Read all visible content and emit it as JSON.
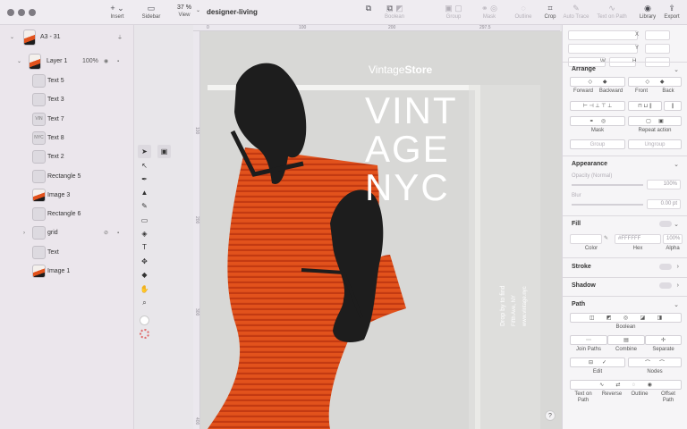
{
  "toolbar": {
    "sidebar_label": "Sidebar",
    "zoom_value": "37 %",
    "view_label": "View",
    "document_title": "designer-living",
    "insert_label": "Insert",
    "boolean_label": "Boolean",
    "group_label": "Group",
    "mask_label": "Mask",
    "outline_label": "Outline",
    "crop_label": "Crop",
    "auto_trace_label": "Auto Trace",
    "text_on_path_label": "Text on Path",
    "library_label": "Library",
    "export_label": "Export"
  },
  "layers": {
    "artboard_name": "A3 - 31",
    "layer1_name": "Layer 1",
    "layer1_opacity": "100%",
    "items": [
      {
        "name": "Text 5",
        "thumb": ""
      },
      {
        "name": "Text 3",
        "thumb": ""
      },
      {
        "name": "Text 7",
        "thumb": "VIN"
      },
      {
        "name": "Text 8",
        "thumb": "NYC"
      },
      {
        "name": "Text 2",
        "thumb": ""
      },
      {
        "name": "Rectangle 5",
        "thumb": ""
      },
      {
        "name": "Image 3",
        "thumb": ""
      },
      {
        "name": "Rectangle 6",
        "thumb": ""
      },
      {
        "name": "grid",
        "thumb": ""
      },
      {
        "name": "Text",
        "thumb": ""
      },
      {
        "name": "Image 1",
        "thumb": ""
      }
    ]
  },
  "ruler": {
    "top": [
      "0",
      "100",
      "200",
      "297.5"
    ],
    "left": [
      "100",
      "200",
      "300",
      "400"
    ]
  },
  "poster": {
    "brand_light": "Vintage",
    "brand_bold": "Store",
    "headline": [
      "VINT",
      "AGE",
      "NYC"
    ],
    "vertical_lines": [
      "Drop by to find",
      "Fifth Ave, NY",
      "www.vintage.nyc"
    ],
    "colors": {
      "orange": "#e2521c",
      "black": "#1d1d1d",
      "paper": "#d8d8d6"
    }
  },
  "inspector": {
    "transform": {
      "x": "X",
      "y": "Y",
      "w": "W",
      "h": "H"
    },
    "arrange": {
      "title": "Arrange",
      "forward": "Forward",
      "backward": "Backward",
      "front": "Front",
      "back": "Back",
      "mask": "Mask",
      "repeat": "Repeat action",
      "group": "Group",
      "ungroup": "Ungroup"
    },
    "appearance": {
      "title": "Appearance",
      "opacity_label": "Opacity (Normal)",
      "opacity_value": "100%",
      "blur_label": "Blur",
      "blur_value": "0.00 pt"
    },
    "fill": {
      "title": "Fill",
      "hex_value": "#FFFFFF",
      "alpha_value": "100%",
      "color_label": "Color",
      "hex_label": "Hex",
      "alpha_label": "Alpha"
    },
    "stroke_title": "Stroke",
    "shadow_title": "Shadow",
    "path": {
      "title": "Path",
      "boolean": "Boolean",
      "join": "Join Paths",
      "combine": "Combine",
      "separate": "Separate",
      "edit": "Edit",
      "nodes": "Nodes",
      "text_on_path": [
        "Text on",
        "Path"
      ],
      "reverse": "Reverse",
      "outline": "Outline",
      "offset_path": [
        "Offset",
        "Path"
      ]
    }
  },
  "help": "?"
}
